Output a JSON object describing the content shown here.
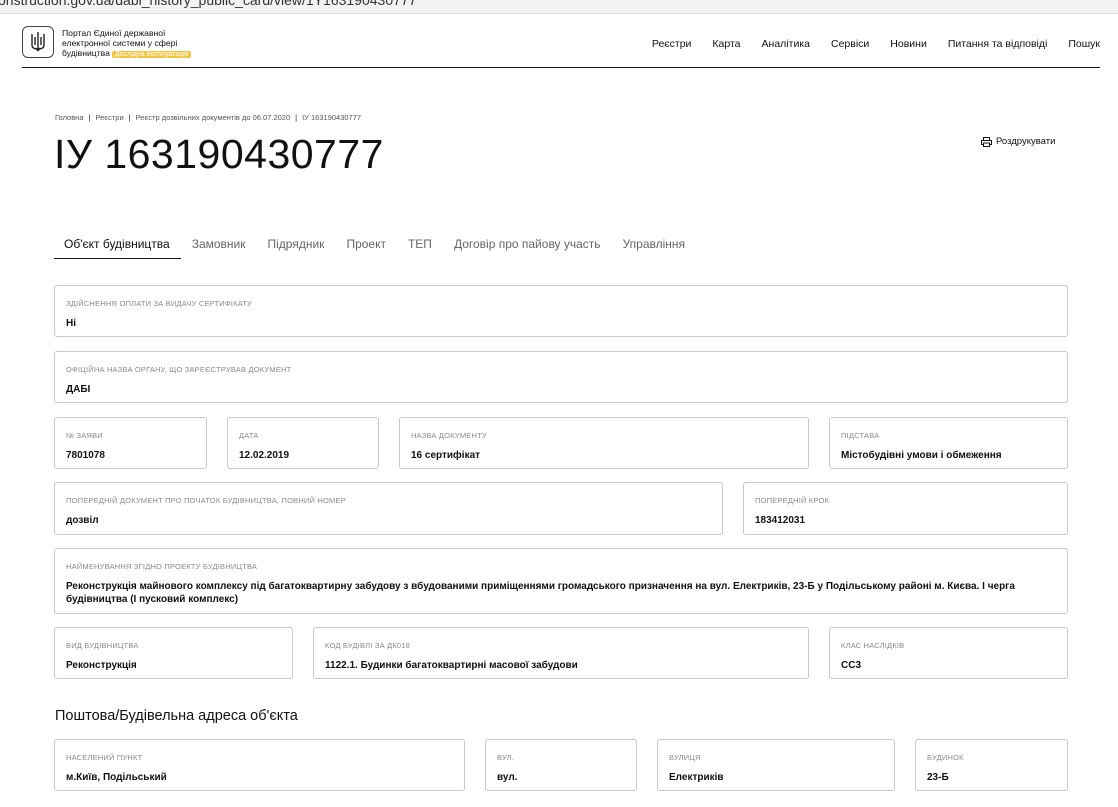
{
  "browser": {
    "url_fragment": "onstruction.gov.ua/dabi_history_public_card/view/1Y163190430777"
  },
  "header": {
    "brand_line1": "Портал Єдиної державної",
    "brand_line2": "електронної системи у сфері",
    "brand_line3": "будівництва",
    "badge": "Дослідна експлуатація",
    "nav": [
      "Реєстри",
      "Карта",
      "Аналітика",
      "Сервіси",
      "Новини",
      "Питання та відповіді",
      "Пошук"
    ]
  },
  "breadcrumb": [
    "Головна",
    "Реєстри",
    "Реєстр дозвільних документів до 06.07.2020",
    "ІУ 163190430777"
  ],
  "page_title": "ІУ 163190430777",
  "print_label": "Роздрукувати",
  "tabs": [
    "Об'єкт будівництва",
    "Замовник",
    "Підрядник",
    "Проект",
    "ТЕП",
    "Договір про пайову участь",
    "Управління"
  ],
  "fields": {
    "payment": {
      "label": "Здійснення оплати за видачу сертифікату",
      "value": "Ні"
    },
    "authority": {
      "label": "Офіційна назва органу, що зареєстрував документ",
      "value": "ДАБІ"
    },
    "app_no": {
      "label": "№ заяви",
      "value": "7801078"
    },
    "date": {
      "label": "Дата",
      "value": "12.02.2019"
    },
    "doc_name": {
      "label": "Назва документу",
      "value": "16 сертифікат"
    },
    "basis": {
      "label": "Підстава",
      "value": "Містобудівні умови і обмеження"
    },
    "prev_doc": {
      "label": "Попередній документ про початок будівництва, повний номер",
      "value": "дозвіл"
    },
    "prev_step": {
      "label": "Попередній крок",
      "value": "183412031"
    },
    "project_name": {
      "label": "Найменування згідно проекту будівництва",
      "value": "Реконструкція майнового комплексу під багатоквартирну забудову з вбудованими приміщеннями громадського призначення на вул. Електриків, 23-Б у Подільському районі м. Києва. І черга будівництва (І пусковий комплекс)"
    },
    "build_type": {
      "label": "Вид будівництва",
      "value": "Реконструкція"
    },
    "dk018": {
      "label": "Код будівлі за ДК018",
      "value": "1122.1. Будинки багатоквартирні масової забудови"
    },
    "class": {
      "label": "Клас наслідків",
      "value": "СС3"
    },
    "settlement": {
      "label": "Населений пункт",
      "value": "м.Київ, Подільський"
    },
    "street_type": {
      "label": "Вул.",
      "value": "вул."
    },
    "street": {
      "label": "Вулиця",
      "value": "Електриків"
    },
    "house": {
      "label": "Будинок",
      "value": "23-Б"
    }
  },
  "address_section_title": "Поштова/Будівельна адреса об'єкта"
}
